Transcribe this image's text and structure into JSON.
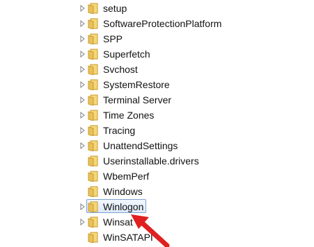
{
  "tree": {
    "items": [
      {
        "label": "setup",
        "has_children": true,
        "selected": false
      },
      {
        "label": "SoftwareProtectionPlatform",
        "has_children": true,
        "selected": false
      },
      {
        "label": "SPP",
        "has_children": true,
        "selected": false
      },
      {
        "label": "Superfetch",
        "has_children": true,
        "selected": false
      },
      {
        "label": "Svchost",
        "has_children": true,
        "selected": false
      },
      {
        "label": "SystemRestore",
        "has_children": true,
        "selected": false
      },
      {
        "label": "Terminal Server",
        "has_children": true,
        "selected": false
      },
      {
        "label": "Time Zones",
        "has_children": true,
        "selected": false
      },
      {
        "label": "Tracing",
        "has_children": true,
        "selected": false
      },
      {
        "label": "UnattendSettings",
        "has_children": true,
        "selected": false
      },
      {
        "label": "Userinstallable.drivers",
        "has_children": false,
        "selected": false
      },
      {
        "label": "WbemPerf",
        "has_children": false,
        "selected": false
      },
      {
        "label": "Windows",
        "has_children": false,
        "selected": false
      },
      {
        "label": "Winlogon",
        "has_children": true,
        "selected": true
      },
      {
        "label": "Winsat",
        "has_children": true,
        "selected": false
      },
      {
        "label": "WinSATAPI",
        "has_children": false,
        "selected": false
      }
    ]
  },
  "colors": {
    "folder": "#e8c15a",
    "folder_dark": "#c99a2e",
    "selection_border": "#7da2ce",
    "arrow": "#e02020"
  },
  "annotation": {
    "icon": "red-arrow-pointer",
    "target": "Winlogon"
  }
}
